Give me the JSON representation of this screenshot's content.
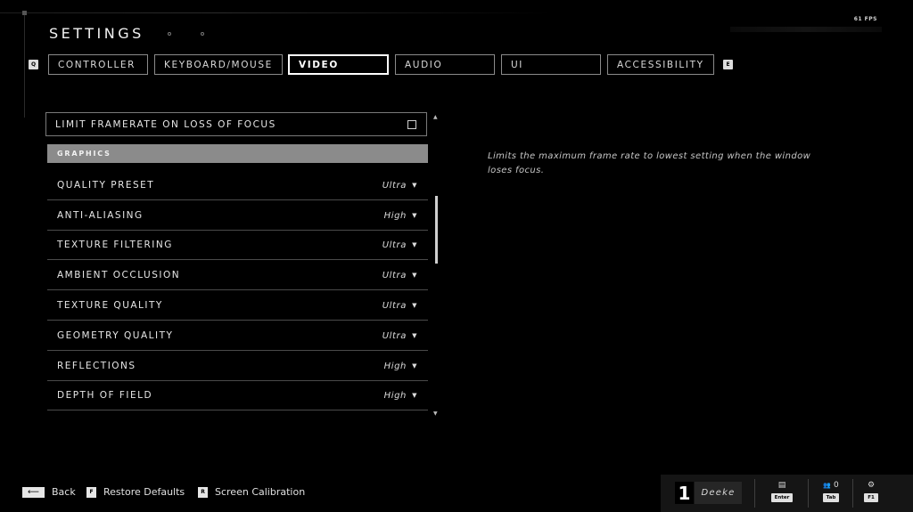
{
  "header": {
    "title": "SETTINGS",
    "fps": "61 FPS",
    "prev_tab_key": "Q",
    "next_tab_key": "E"
  },
  "tabs": [
    {
      "label": "CONTROLLER",
      "active": false
    },
    {
      "label": "KEYBOARD/MOUSE",
      "active": false
    },
    {
      "label": "VIDEO",
      "active": true
    },
    {
      "label": "AUDIO",
      "active": false
    },
    {
      "label": "UI",
      "active": false
    },
    {
      "label": "ACCESSIBILITY",
      "active": false
    }
  ],
  "settings": {
    "limit_framerate": {
      "label": "LIMIT FRAMERATE ON LOSS OF FOCUS",
      "checked": false
    },
    "section_header": "GRAPHICS",
    "rows": [
      {
        "label": "QUALITY PRESET",
        "value": "Ultra"
      },
      {
        "label": "ANTI-ALIASING",
        "value": "High"
      },
      {
        "label": "TEXTURE FILTERING",
        "value": "Ultra"
      },
      {
        "label": "AMBIENT OCCLUSION",
        "value": "Ultra"
      },
      {
        "label": "TEXTURE QUALITY",
        "value": "Ultra"
      },
      {
        "label": "GEOMETRY QUALITY",
        "value": "Ultra"
      },
      {
        "label": "REFLECTIONS",
        "value": "High"
      },
      {
        "label": "DEPTH OF FIELD",
        "value": "High"
      }
    ]
  },
  "description": "Limits the maximum frame rate to lowest setting when the window loses focus.",
  "footer": {
    "back_label": "Back",
    "restore_key": "F",
    "restore_label": "Restore Defaults",
    "calibration_key": "R",
    "calibration_label": "Screen Calibration"
  },
  "player": {
    "number": "1",
    "name": "Deeke",
    "chat_key": "Enter",
    "party_count": "0",
    "party_key": "Tab",
    "settings_key": "F1"
  },
  "icons": {
    "dropdown": "▼",
    "back": "⟵",
    "chat": "▤",
    "party": "👥",
    "gear": "⚙"
  }
}
